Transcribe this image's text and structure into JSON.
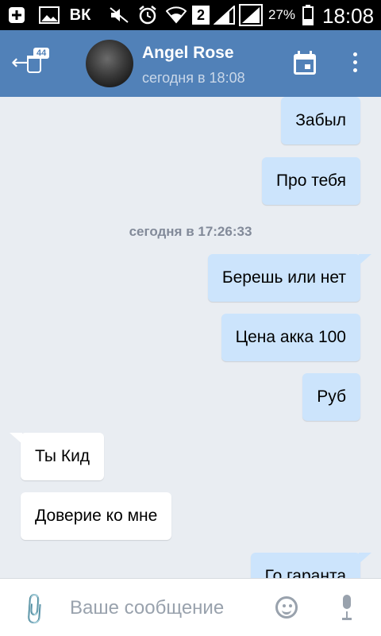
{
  "status_bar": {
    "battery_percent": "27%",
    "time": "18:08",
    "network_badge": "2"
  },
  "header": {
    "unread_badge": "44",
    "contact_name": "Angel Rose",
    "last_seen": "сегодня в 18:08"
  },
  "chat": {
    "date_separator": "сегодня в 17:26:33",
    "messages": [
      {
        "direction": "out",
        "text": "Забыл"
      },
      {
        "direction": "out",
        "text": "Про тебя"
      },
      {
        "direction": "out",
        "text": "Берешь или нет"
      },
      {
        "direction": "out",
        "text": "Цена акка 100"
      },
      {
        "direction": "out",
        "text": "Руб"
      },
      {
        "direction": "in",
        "text": "Ты Кид"
      },
      {
        "direction": "in",
        "text": "Доверие ко мне"
      },
      {
        "direction": "out",
        "text": "Го гаранта"
      }
    ]
  },
  "composer": {
    "placeholder": "Ваше сообщение"
  },
  "colors": {
    "header": "#5181b8",
    "outgoing_bubble": "#cce4fc",
    "incoming_bubble": "#ffffff",
    "chat_background": "#e9edf2"
  },
  "icons": [
    "plus-box-icon",
    "gallery-icon",
    "vk-icon",
    "mute-icon",
    "alarm-icon",
    "wifi-icon",
    "signal-icon",
    "battery-icon",
    "back-arrow-icon",
    "cup-icon",
    "calendar-icon",
    "more-vert-icon",
    "attach-icon",
    "emoji-icon",
    "mic-icon"
  ]
}
